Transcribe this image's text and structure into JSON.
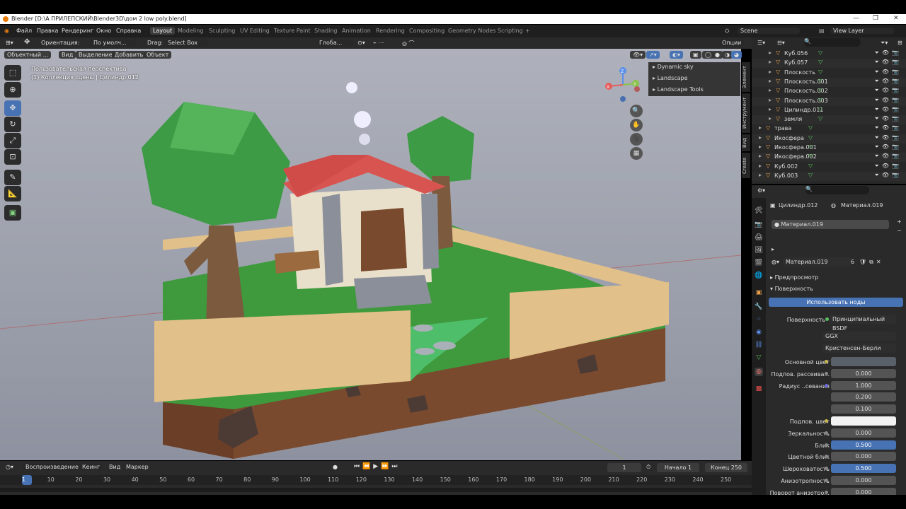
{
  "titlebar": {
    "title": "Blender [D:\\А ПРИЛЕПСКИЙ\\Blender3D\\дом 2 low poly.blend]",
    "min": "—",
    "max": "❐",
    "close": "✕"
  },
  "menu": {
    "items": [
      "Файл",
      "Правка",
      "Рендеринг",
      "Окно",
      "Справка"
    ],
    "workspaces": [
      "Layout",
      "Modeling",
      "Sculpting",
      "UV Editing",
      "Texture Paint",
      "Shading",
      "Animation",
      "Rendering",
      "Compositing",
      "Geometry Nodes",
      "Scripting"
    ],
    "add": "+",
    "scene": "Scene",
    "view_layer": "View Layer"
  },
  "toolheader": {
    "orientation_label": "Ориентация:",
    "orientation_value": "По умолч...",
    "drag_label": "Drag:",
    "drag_value": "Select Box",
    "transform": "Глоба...",
    "options": "Опции"
  },
  "viewport_header": {
    "mode": "Объектный ...",
    "view": "Вид",
    "select": "Выделение",
    "add": "Добавить",
    "object": "Объект"
  },
  "overlay": {
    "line1": "Пользовательская перспектива",
    "line2": "(1) Коллекция сцены | Цилиндр.012"
  },
  "gizmo": {
    "x": "X",
    "y": "Y",
    "z": "Z"
  },
  "npanel": {
    "items": [
      "Dynamic sky",
      "Landscape",
      "Landscape Tools"
    ]
  },
  "vtabs": [
    "Элемент",
    "Инструмент",
    "Вид",
    "Create"
  ],
  "outliner": {
    "rows": [
      {
        "name": "Куб.056",
        "indent": 2
      },
      {
        "name": "Куб.057",
        "indent": 2
      },
      {
        "name": "Плоскость",
        "indent": 2
      },
      {
        "name": "Плоскость.001",
        "indent": 2
      },
      {
        "name": "Плоскость.002",
        "indent": 2
      },
      {
        "name": "Плоскость.003",
        "indent": 2
      },
      {
        "name": "Цилиндр.011",
        "indent": 2
      },
      {
        "name": "земля",
        "indent": 2
      },
      {
        "name": "трава",
        "indent": 1
      },
      {
        "name": "Икосфера",
        "indent": 1
      },
      {
        "name": "Икосфера.001",
        "indent": 1
      },
      {
        "name": "Икосфера.002",
        "indent": 1
      },
      {
        "name": "Куб.002",
        "indent": 1
      },
      {
        "name": "Куб.003",
        "indent": 1
      }
    ]
  },
  "properties": {
    "object": "Цилиндр.012",
    "material_tab": "Материал.019",
    "slot": "Материал.019",
    "material_name": "Материал.019",
    "users": "6",
    "preview": "Предпросмотр",
    "surface_section": "Поверхность",
    "use_nodes": "Использовать ноды",
    "surface_label": "Поверхность",
    "surface_value": "Принципиальный BSDF",
    "distribution": "GGX",
    "subsurface_method": "Кристенсен-Берли",
    "fields": [
      {
        "label": "Основной цвет",
        "value": "",
        "type": "color-dark",
        "dot": "y"
      },
      {
        "label": "Подпов. рассеива...",
        "value": "0.000",
        "type": "num",
        "dot": "g"
      },
      {
        "label": "Радиус ..севания",
        "value": "1.000",
        "type": "num",
        "dot": "b"
      },
      {
        "label": "",
        "value": "0.200",
        "type": "num",
        "dot": ""
      },
      {
        "label": "",
        "value": "0.100",
        "type": "num",
        "dot": ""
      },
      {
        "label": "Подпов. цвет",
        "value": "",
        "type": "color-light",
        "dot": "y"
      },
      {
        "label": "Зеркальность",
        "value": "0.000",
        "type": "num",
        "dot": "g"
      },
      {
        "label": "Блик",
        "value": "0.500",
        "type": "blue",
        "dot": "g"
      },
      {
        "label": "Цветной блик",
        "value": "0.000",
        "type": "num",
        "dot": "g"
      },
      {
        "label": "Шероховатость",
        "value": "0.500",
        "type": "blue",
        "dot": "g"
      },
      {
        "label": "Анизотропность",
        "value": "0.000",
        "type": "num",
        "dot": "g"
      },
      {
        "label": "Поворот анизотро...",
        "value": "0.000",
        "type": "num",
        "dot": "g"
      }
    ]
  },
  "timeline": {
    "playback": "Воспроизведение",
    "keying": "Кеинг",
    "view": "Вид",
    "marker": "Маркер",
    "current": "1",
    "start_label": "Начало",
    "start": "1",
    "end_label": "Конец",
    "end": "250",
    "ticks": [
      "1",
      "10",
      "20",
      "30",
      "40",
      "50",
      "60",
      "70",
      "80",
      "90",
      "100",
      "110",
      "120",
      "130",
      "140",
      "150",
      "160",
      "170",
      "180",
      "190",
      "200",
      "210",
      "220",
      "230",
      "240",
      "250"
    ]
  },
  "colors": {
    "accent": "#4772b3",
    "header": "#1f1f1f",
    "panel": "#2a2a2a"
  }
}
